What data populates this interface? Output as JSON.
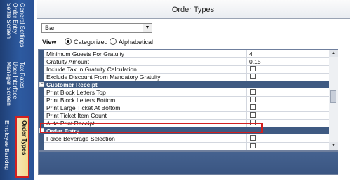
{
  "sidebar": {
    "tabs": [
      {
        "lines": [
          "General Settings",
          "Order Entry",
          "Settle Screen"
        ]
      },
      {
        "lines": [
          "Tax Rates",
          "User Interface",
          "Manager Screen"
        ]
      },
      {
        "lines": [
          "Order Types",
          "Employee Banking"
        ]
      }
    ],
    "active_tab_label": "Order Types"
  },
  "header": {
    "title": "Order Types"
  },
  "order_type_select": {
    "value": "Bar"
  },
  "view": {
    "label": "View",
    "options": [
      "Categorized",
      "Alphabetical"
    ],
    "selected": "Categorized"
  },
  "grid": {
    "rows": [
      {
        "kind": "prop",
        "name": "Minimum Guests For Gratuity",
        "value": "4"
      },
      {
        "kind": "prop",
        "name": "Gratuity Amount",
        "value": "0.15"
      },
      {
        "kind": "prop",
        "name": "Include Tax In Gratuity Calculation",
        "value": ""
      },
      {
        "kind": "prop",
        "name": "Exclude Discount From Mandatory Gratuity",
        "value": ""
      },
      {
        "kind": "cat",
        "name": "Customer Receipt"
      },
      {
        "kind": "prop",
        "name": "Print Block Letters Top",
        "value": ""
      },
      {
        "kind": "prop",
        "name": "Print Block Letters Bottom",
        "value": ""
      },
      {
        "kind": "prop",
        "name": "Print Large Ticket At Bottom",
        "value": ""
      },
      {
        "kind": "prop",
        "name": "Print Ticket Item Count",
        "value": ""
      },
      {
        "kind": "prop",
        "name": "Auto Print Receipt",
        "value": ""
      },
      {
        "kind": "cat",
        "name": "Order Entry"
      },
      {
        "kind": "prop",
        "name": "Force Beverage Selection",
        "value": ""
      },
      {
        "kind": "prop",
        "name": "",
        "value": ""
      }
    ]
  },
  "icons": {
    "expander": "collapse-icon",
    "dropdown": "chevron-down-icon",
    "scroll_up": "scroll-up-icon",
    "scroll_down": "scroll-down-icon"
  },
  "colors": {
    "sidebar": "#2d5aa0",
    "category_band": "#3f5a82",
    "active_tab": "#f2d98c",
    "highlight": "#d32020"
  }
}
